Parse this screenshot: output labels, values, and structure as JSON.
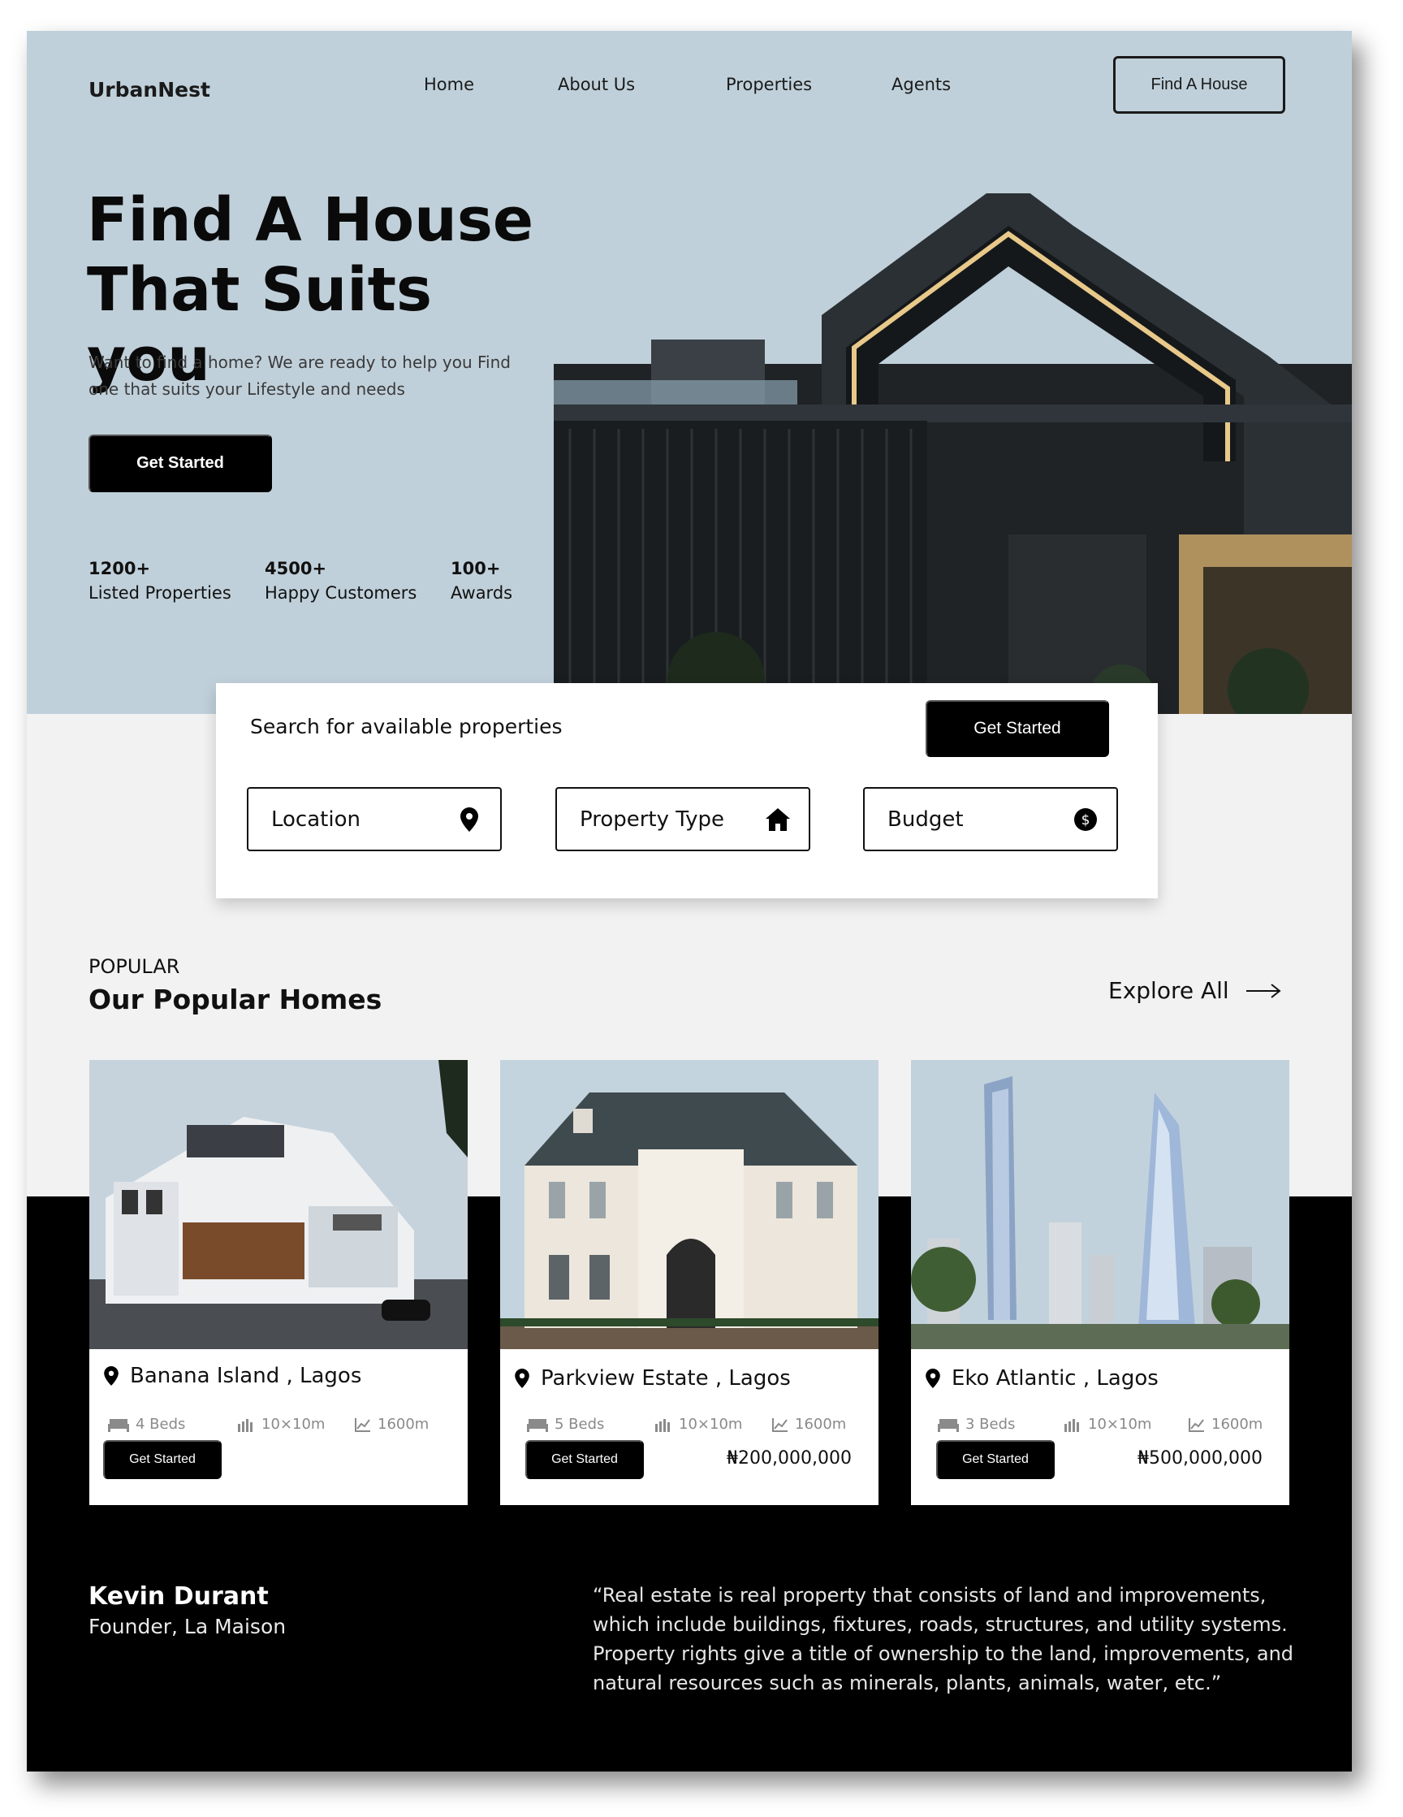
{
  "header": {
    "brand": "UrbanNest",
    "nav": [
      "Home",
      "About Us",
      "Properties",
      "Agents"
    ],
    "cta": "Find A House"
  },
  "hero": {
    "title_line1": "Find A House",
    "title_line2": "That Suits you",
    "subtitle": "Want to find a home? We are ready to help you Find one that suits your Lifestyle and needs",
    "button": "Get Started",
    "stats": [
      {
        "value": "1200+",
        "label": "Listed Properties"
      },
      {
        "value": "4500+",
        "label": "Happy Customers"
      },
      {
        "value": "100+",
        "label": "Awards"
      }
    ]
  },
  "search": {
    "label": "Search for available properties",
    "button": "Get Started",
    "fields": [
      {
        "label": "Location",
        "icon": "location-pin-icon"
      },
      {
        "label": "Property Type",
        "icon": "house-icon"
      },
      {
        "label": "Budget",
        "icon": "dollar-coin-icon"
      }
    ]
  },
  "popular": {
    "tag": "POPULAR",
    "title": "Our Popular Homes",
    "explore": "Explore All",
    "cards": [
      {
        "location": "Banana Island , Lagos",
        "beds": "4 Beds",
        "size": "10×10m",
        "area": "1600m",
        "button": "Get Started",
        "price": ""
      },
      {
        "location": "Parkview Estate , Lagos",
        "beds": "5 Beds",
        "size": "10×10m",
        "area": "1600m",
        "button": "Get Started",
        "price": "₦200,000,000"
      },
      {
        "location": "Eko Atlantic , Lagos",
        "beds": "3 Beds",
        "size": "10×10m",
        "area": "1600m",
        "button": "Get Started",
        "price": "₦500,000,000"
      }
    ]
  },
  "testimonial": {
    "name": "Kevin Durant",
    "role": "Founder, La Maison",
    "quote": "“Real estate is real property that consists of land and improvements, which include buildings, fixtures, roads, structures, and utility systems. Property rights give a title of ownership to the land, improvements, and natural resources such as minerals, plants, animals, water, etc.”"
  },
  "colors": {
    "hero_bg": "#c0d0da",
    "page_bg": "#f2f2f2",
    "dark": "#000000",
    "text_muted": "#8a8a8a"
  }
}
